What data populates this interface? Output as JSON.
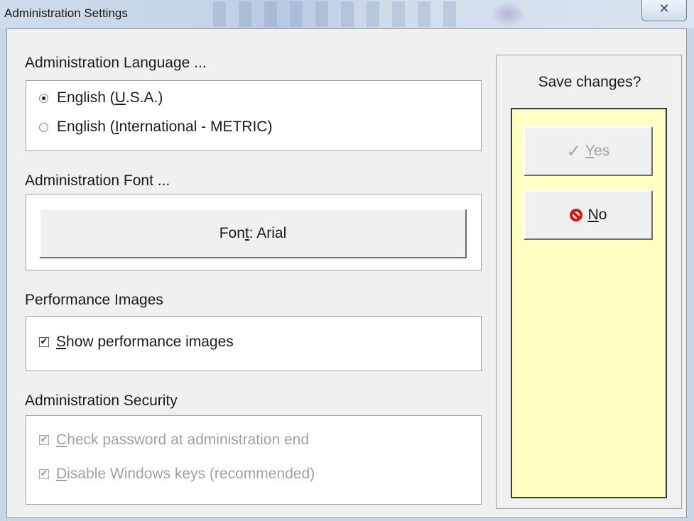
{
  "window": {
    "title": "Administration Settings",
    "close_glyph": "✕"
  },
  "language": {
    "label": "Administration Language ...",
    "options": [
      {
        "prefix": "English (",
        "mnemonic": "U",
        "suffix": ".S.A.)",
        "selected": true
      },
      {
        "prefix": "English (",
        "mnemonic": "I",
        "suffix": "nternational - METRIC)",
        "selected": false
      }
    ]
  },
  "font": {
    "label": "Administration Font ...",
    "button_prefix": "Fon",
    "button_mnemonic": "t",
    "button_suffix": ": Arial"
  },
  "performance": {
    "label": "Performance Images",
    "checkbox_mnemonic": "S",
    "checkbox_rest": "how performance images",
    "checked": true
  },
  "security": {
    "label": "Administration Security",
    "items": [
      {
        "mnemonic": "C",
        "rest": "heck password at administration end",
        "checked": true,
        "enabled": false
      },
      {
        "mnemonic": "D",
        "rest": "isable Windows keys (recommended)",
        "checked": true,
        "enabled": false
      }
    ]
  },
  "save_panel": {
    "label": "Save changes?",
    "yes": {
      "mnemonic": "Y",
      "rest": "es",
      "enabled": false
    },
    "no": {
      "mnemonic": "N",
      "rest": "o",
      "enabled": true
    }
  },
  "colors": {
    "panel_yellow": "#ffffc4",
    "no_icon_red": "#cc1a1a"
  }
}
